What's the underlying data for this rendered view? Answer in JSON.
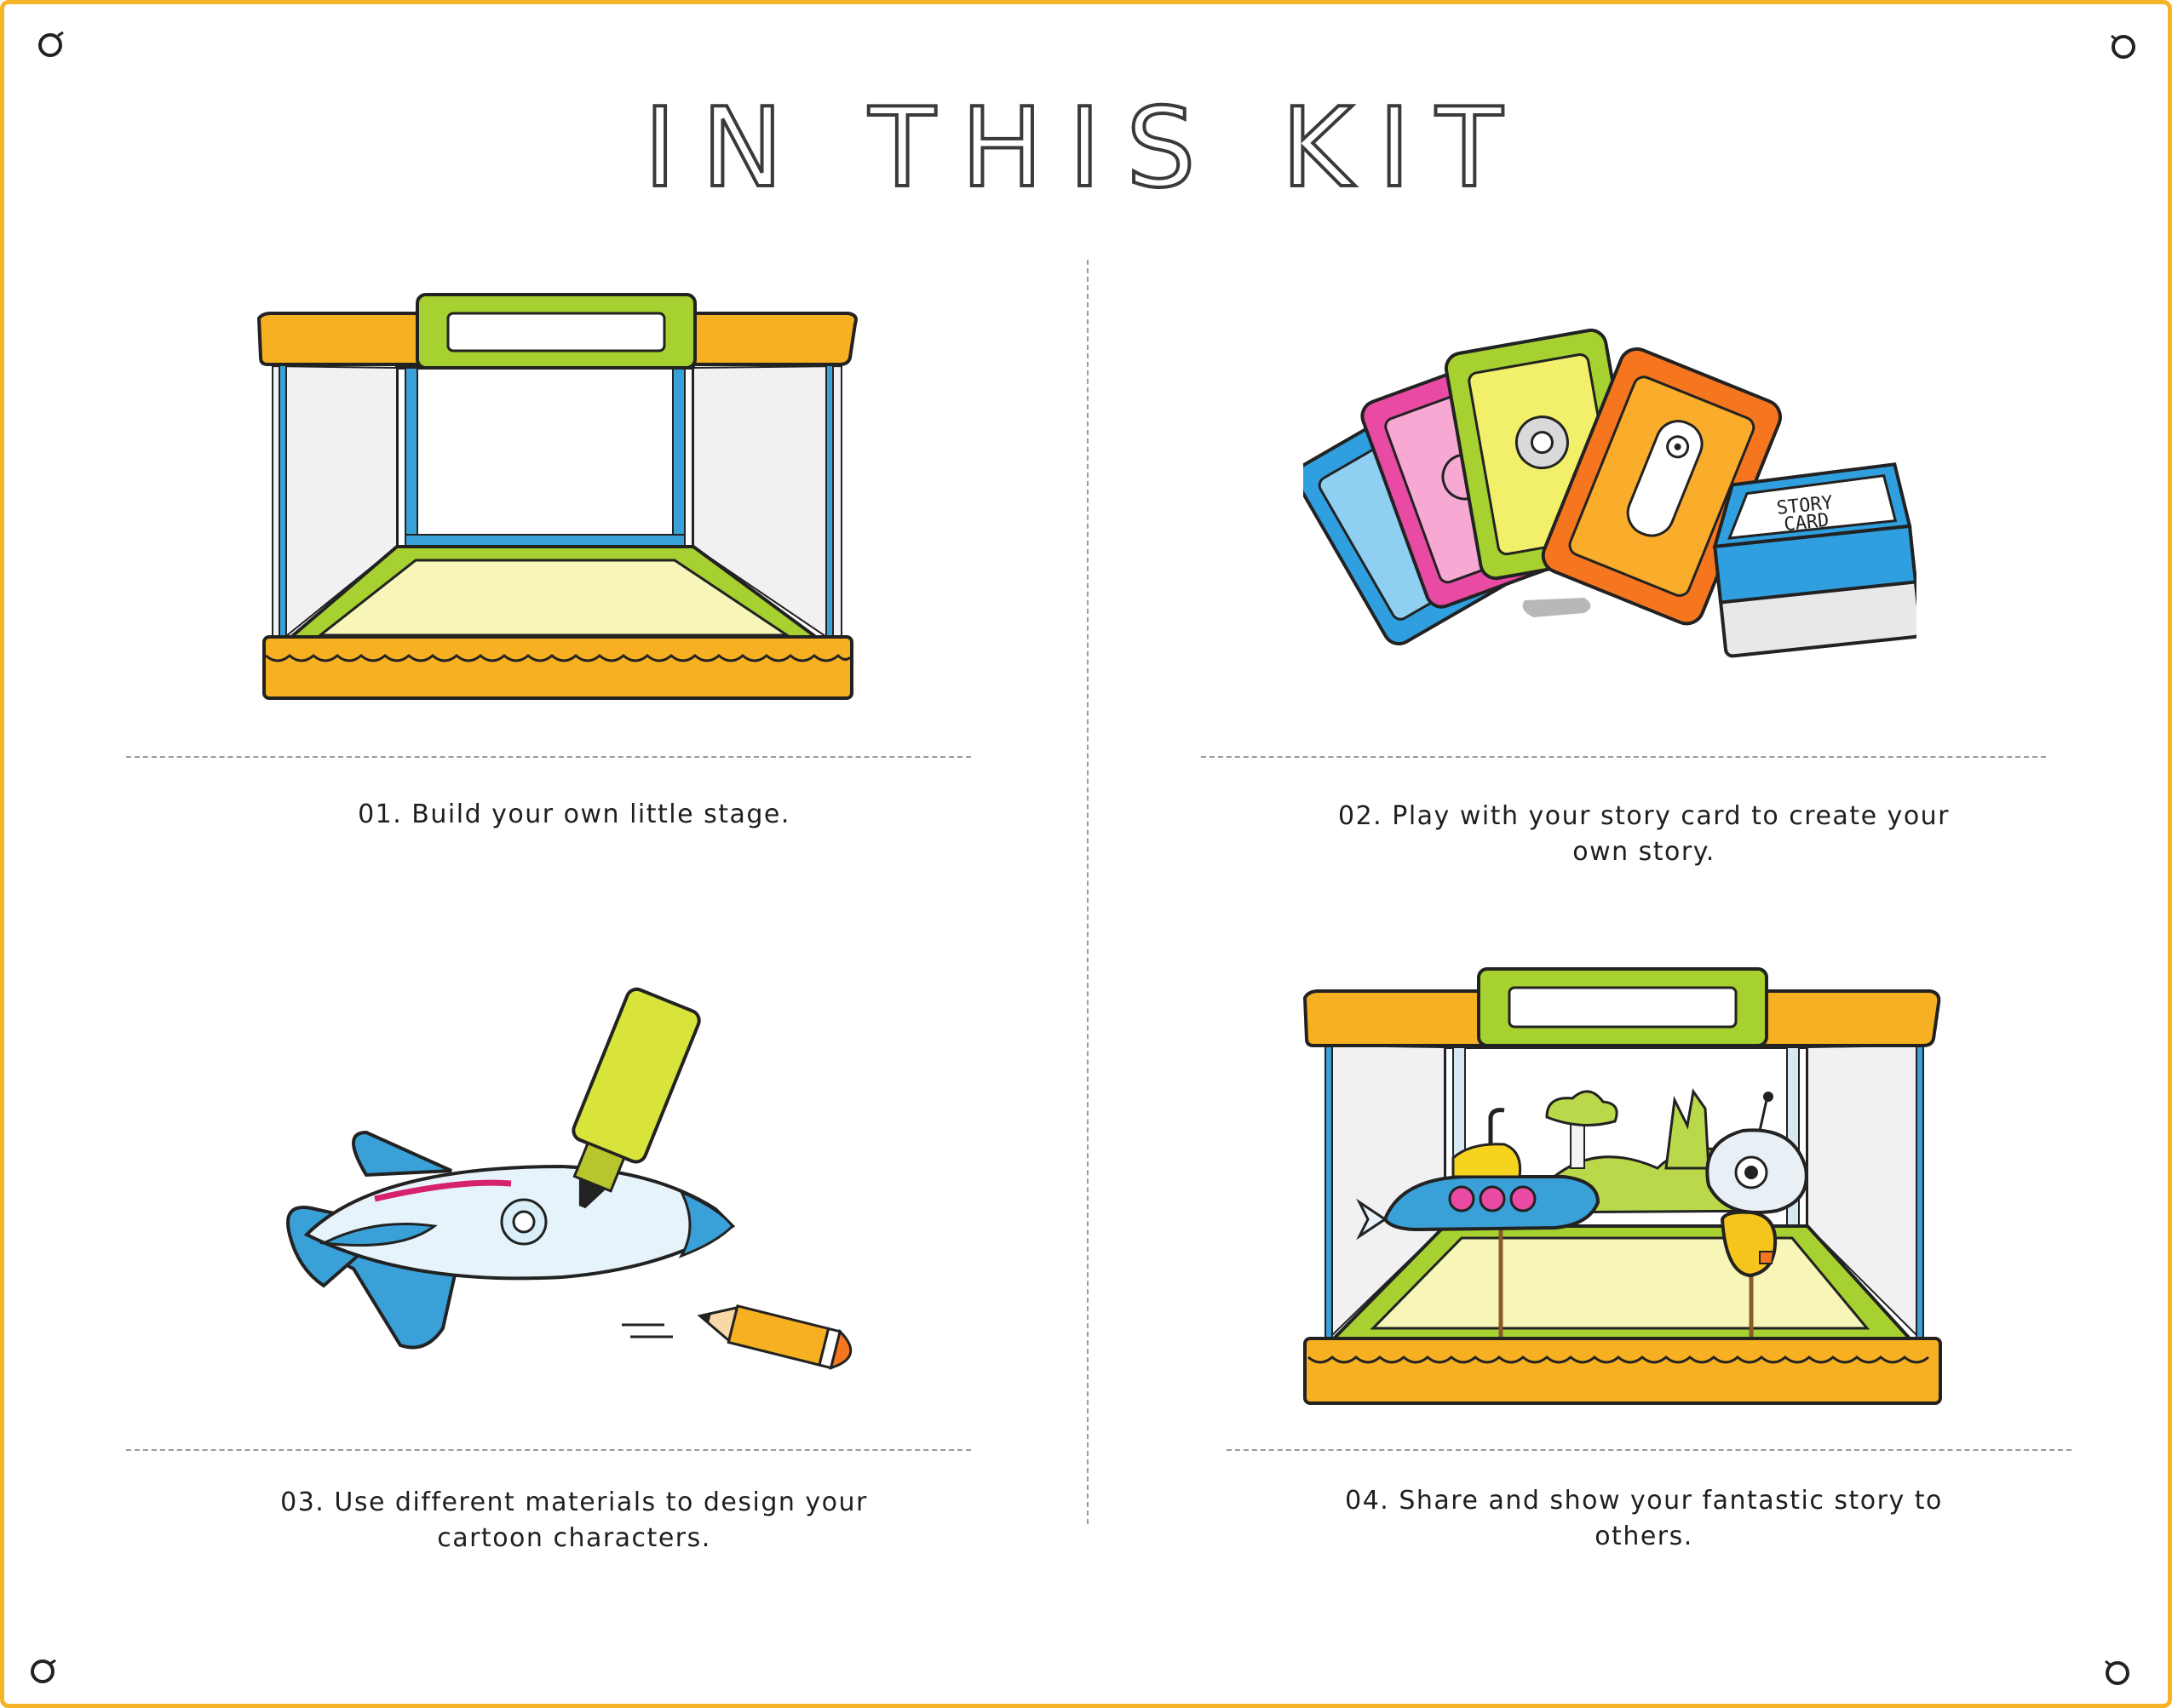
{
  "page": {
    "title": "IN THIS KIT",
    "accent_color": "#f5b427"
  },
  "steps": [
    {
      "caption": "01. Build your own little stage.",
      "illustration": "stage-icon"
    },
    {
      "caption": "02. Play with your story card to create your own story.",
      "illustration": "story-cards-icon",
      "deck_label_line1": "STORY",
      "deck_label_line2": "CARD"
    },
    {
      "caption": "03. Use different materials to design your cartoon characters.",
      "illustration": "rocket-marker-icon"
    },
    {
      "caption": "04. Share and show your fantastic story to others.",
      "illustration": "stage-with-characters-icon"
    }
  ]
}
